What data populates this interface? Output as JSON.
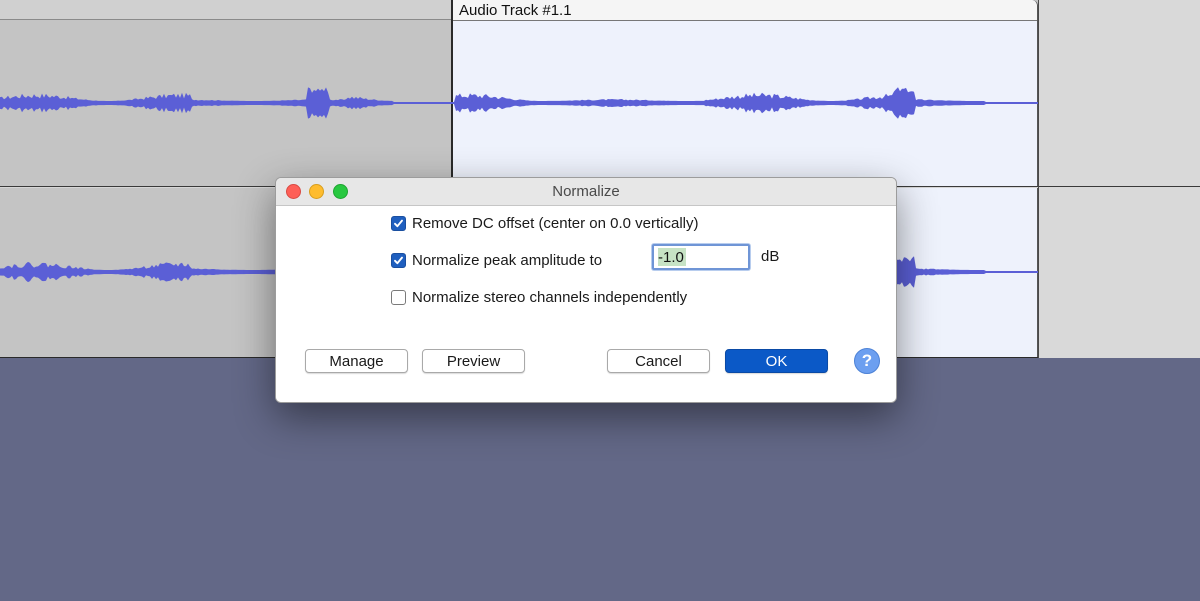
{
  "track": {
    "clip_title": "Audio Track #1.1"
  },
  "dialog": {
    "title": "Normalize",
    "options": [
      {
        "label": "Remove DC offset (center on 0.0 vertically)",
        "checked": true
      },
      {
        "label": "Normalize peak amplitude to",
        "checked": true
      },
      {
        "label": "Normalize stereo channels independently",
        "checked": false
      }
    ],
    "peak_value": "-1.0",
    "peak_unit": "dB",
    "buttons": {
      "manage": "Manage",
      "preview": "Preview",
      "cancel": "Cancel",
      "ok": "OK",
      "help": "?"
    }
  },
  "colors": {
    "waveform": "#5b5fd6",
    "selection_bg": "#eef2fc",
    "background": "#636887",
    "accent": "#0b59c7"
  }
}
